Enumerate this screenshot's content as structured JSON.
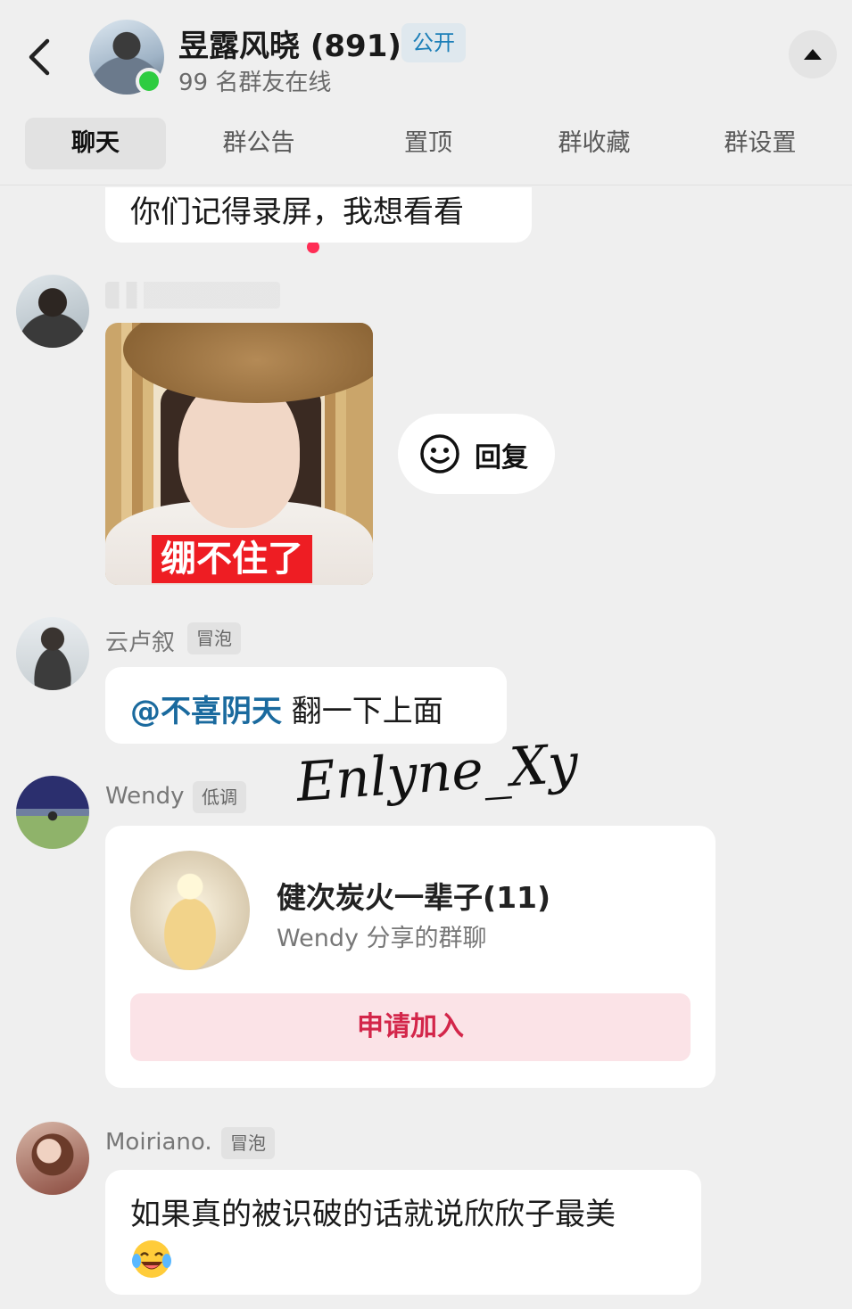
{
  "header": {
    "group_name": "昱露风晓 (891)",
    "public_badge": "公开",
    "online_count": "99 名群友在线"
  },
  "tabs": [
    {
      "label": "聊天",
      "active": true
    },
    {
      "label": "群公告",
      "has_dot": true
    },
    {
      "label": "置顶"
    },
    {
      "label": "群收藏"
    },
    {
      "label": "群设置"
    }
  ],
  "messages": [
    {
      "text": "你们记得录屏，我想看看"
    },
    {
      "image_caption": "绷不住了",
      "reply_label": "回复"
    },
    {
      "sender": "云卢叙",
      "tag": "冒泡",
      "mention": "@不喜阴天",
      "text": " 翻一下上面"
    },
    {
      "sender": "Wendy",
      "tag": "低调",
      "card": {
        "title": "健次炭火一辈子(11)",
        "subtitle": "Wendy 分享的群聊",
        "button": "申请加入"
      }
    },
    {
      "sender": "Moiriano.",
      "tag": "冒泡",
      "text": "如果真的被识破的话就说欣欣子最美"
    }
  ],
  "watermark": "Enlyne_Xy",
  "colors": {
    "accent_blue": "#1c7fb8",
    "mention": "#1a6a9e",
    "join_text": "#d3264a",
    "online": "#2ecc40",
    "caption_red": "#ee1d23"
  }
}
